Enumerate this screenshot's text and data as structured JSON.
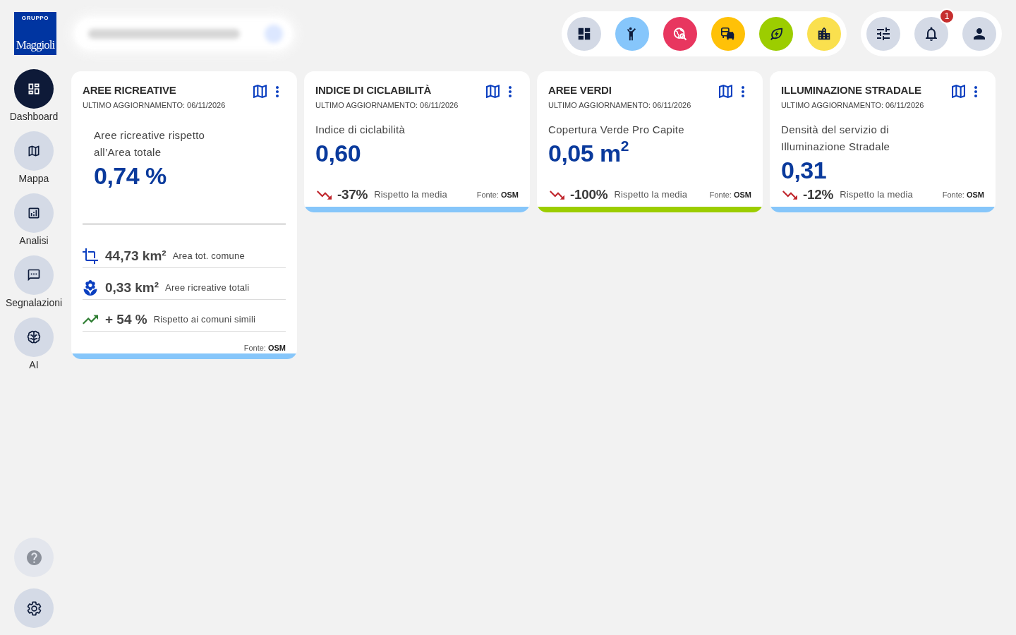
{
  "logo": {
    "tagline": "GRUPPO",
    "wordmark": "Maggioli"
  },
  "sidebar": {
    "items": [
      {
        "label": "Dashboard",
        "selected": true
      },
      {
        "label": "Mappa",
        "selected": false
      },
      {
        "label": "Analisi",
        "selected": false
      },
      {
        "label": "Segnalazioni",
        "selected": false
      },
      {
        "label": "AI",
        "selected": false
      }
    ]
  },
  "category_buttons": [
    {
      "color": "#d3d9e5"
    },
    {
      "color": "#86c6fb"
    },
    {
      "color": "#e8365f"
    },
    {
      "color": "#ffc107"
    },
    {
      "color": "#9ccd00"
    },
    {
      "color": "#fae04e"
    }
  ],
  "notifications": {
    "badge": "1"
  },
  "cards": [
    {
      "kind": "detailed",
      "title": "AREE RICREATIVE",
      "updated": "ULTIMO AGGIORNAMENTO: 06/11/2026",
      "description": "Aree ricreative rispetto all’Area totale",
      "value": "0,74 %",
      "stats": [
        {
          "value": "44,73 km²",
          "label": "Area tot. comune"
        },
        {
          "value": "0,33 km²",
          "label": "Aree ricreative totali"
        },
        {
          "value": "+ 54 %",
          "label": "Rispetto ai comuni simili"
        }
      ],
      "source": "Fonte: **OSM**",
      "color": "#86c6fa"
    },
    {
      "kind": "summary",
      "title": "INDICE DI CICLABILITÀ",
      "updated": "ULTIMO AGGIORNAMENTO: 06/11/2026",
      "description": "Indice di ciclabilità",
      "value": "0,60",
      "trend": {
        "kind": "down",
        "value": "-37%",
        "label": "Rispetto la media"
      },
      "source": "Fonte: **OSM**",
      "color": "#86c6fa"
    },
    {
      "kind": "summary",
      "title": "AREE VERDI",
      "updated": "ULTIMO AGGIORNAMENTO: 06/11/2026",
      "description": "Copertura Verde Pro Capite",
      "value": "0,05 m$^{2}$",
      "trend": {
        "kind": "down",
        "value": "-100%",
        "label": "Rispetto la media"
      },
      "source": "Fonte: **OSM**",
      "color": "#9ccd00"
    },
    {
      "kind": "summary",
      "title": "ILLUMINAZIONE STRADALE",
      "updated": "ULTIMO AGGIORNAMENTO: 06/11/2026",
      "description": "Densità del servizio di Illuminazione Stradale",
      "value": "0,31",
      "trend": {
        "kind": "down",
        "value": "-12%",
        "label": "Rispetto la media"
      },
      "source": "Fonte: **OSM**",
      "color": "#86c6fa"
    }
  ]
}
